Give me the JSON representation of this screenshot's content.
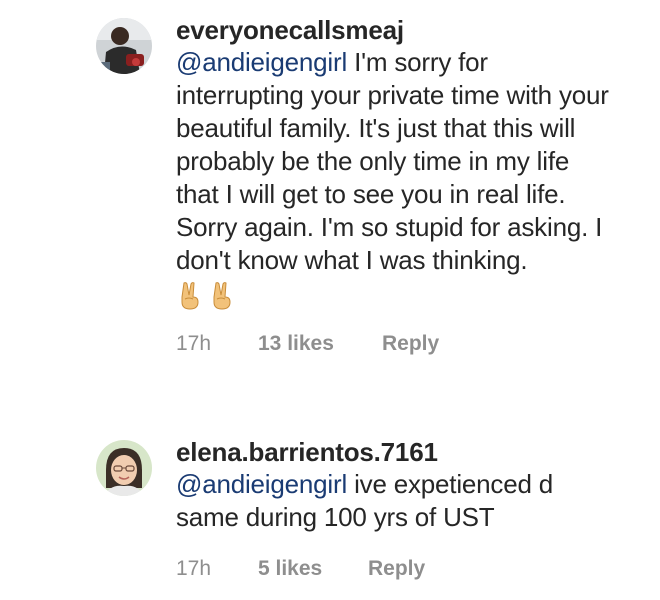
{
  "comments": [
    {
      "username": "everyonecallsmeaj",
      "mention": "@andieigengirl",
      "text": " I'm sorry for interrupting your private time with your beautiful family. It's just that this will probably be the only time in my life that I will get to see you in real life. Sorry again. I'm so stupid for asking. I don't know what I was thinking.",
      "emojis": [
        "victory-hand-icon",
        "victory-hand-icon"
      ],
      "time": "17h",
      "likes": "13 likes",
      "reply": "Reply"
    },
    {
      "username": "elena.barrientos.7161",
      "mention": "@andieigengirl",
      "text": " ive expetienced d same during 100 yrs of UST",
      "time": "17h",
      "likes": "5 likes",
      "reply": "Reply"
    }
  ]
}
